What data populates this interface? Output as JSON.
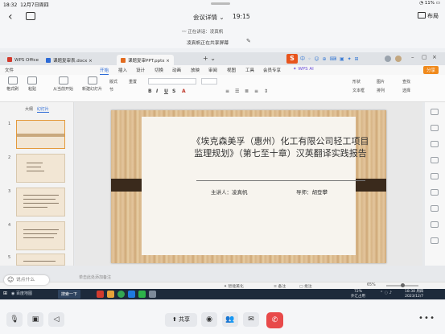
{
  "status_bar": {
    "time": "18:32",
    "date": "12月7日周四",
    "battery": "11%"
  },
  "meeting": {
    "title": "会议详情",
    "title_caret": "⌄",
    "elapsed": "19:15",
    "speaking": "正在讲话：凌真帆",
    "sharing": "凌真帆正在共享屏幕",
    "layout_label": "布局"
  },
  "wps": {
    "tabs": [
      {
        "label": "WPS Office",
        "color": "#d23b2e"
      },
      {
        "label": "课题复审表.docx",
        "color": "#2c6ad6"
      },
      {
        "label": "课题复审PPT.pptx",
        "color": "#e26b1f"
      }
    ],
    "ime_glyphs": "中 ◦ ☺ ⊕ ⌨ ▣ ✦ ⊞",
    "menu": [
      "文件",
      "开始",
      "插入",
      "设计",
      "切换",
      "动画",
      "放映",
      "审阅",
      "视图",
      "工具",
      "会员专享"
    ],
    "wps_ai": "WPS AI",
    "share_label": "分享",
    "toolbar": {
      "format_painter": "格式刷",
      "paste": "粘贴",
      "from_current": "从当前开始",
      "new_slide": "新建幻灯片",
      "layout": "版式",
      "section": "节",
      "reset": "重置",
      "shape": "形状",
      "picture": "图片",
      "textbox": "文本框",
      "arrange": "排列",
      "find": "查找",
      "select": "选择"
    },
    "left_tabs": [
      "大纲",
      "幻灯片"
    ],
    "slide_numbers": [
      "1",
      "2",
      "3",
      "4",
      "5"
    ],
    "notes_placeholder": "单击此处添加备注",
    "status": {
      "smart_beautify": "智能美化",
      "notes": "备注",
      "comments": "批注",
      "zoom": "65%"
    }
  },
  "slide": {
    "title": "《埃克森美孚（惠州）化工有限公司轻工项目监理规划》（第七至十章）汉英翻译实践报告",
    "presenter": "主讲人：凌真帆",
    "advisor": "导师：胡登攀"
  },
  "taskbar": {
    "search": "搜索一下",
    "browser_label": "百度地图",
    "weather": "72%",
    "weather_sub": "外汇占用",
    "clock_time": "18:38 周四",
    "clock_date": "2023/12/7"
  },
  "controls": {
    "share_label": "共享",
    "more": "• • •"
  }
}
